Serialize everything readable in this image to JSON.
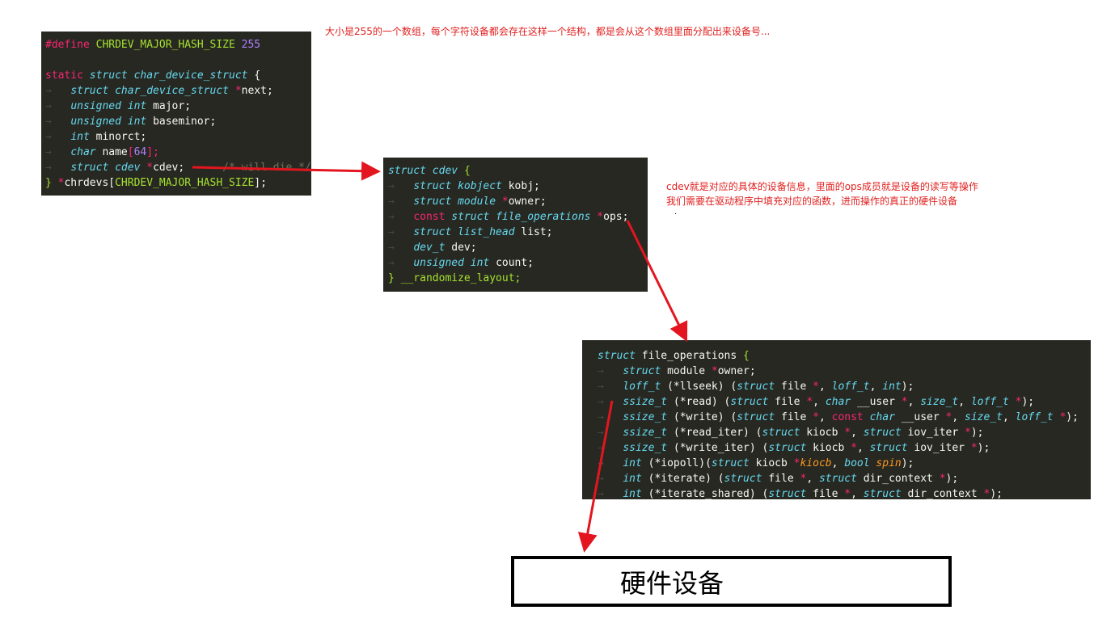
{
  "annotations": {
    "top_note": "大小是255的一个数组，每个字符设备都会存在这样一个结构，都是会从这个数组里面分配出来设备号...",
    "cdev_note_line1": "cdev就是对应的具体的设备信息，里面的ops成员就是设备的读写等操作",
    "cdev_note_line2": "我们需要在驱动程序中填充对应的函数，进而操作的真正的硬件设备",
    "cdev_note_dot": "."
  },
  "hardware_box": {
    "label": "硬件设备"
  },
  "code_char_device": {
    "define_kw": "#define",
    "define_name": "CHRDEV_MAJOR_HASH_SIZE",
    "define_value": "255",
    "static_kw": "static",
    "struct_kw": "struct",
    "struct_name": "char_device_struct",
    "open_brace": "{",
    "next_type": "struct char_device_struct",
    "next_star": "*",
    "next_name": "next;",
    "major_type": "unsigned int",
    "major_name": "major;",
    "baseminor_type": "unsigned int",
    "baseminor_name": "baseminor;",
    "minorct_type": "int",
    "minorct_name": "minorct;",
    "name_type": "char",
    "name_name": "name",
    "name_open": "[",
    "name_size": "64",
    "name_close": "];",
    "cdev_type": "struct cdev",
    "cdev_star": "*",
    "cdev_name": "cdev;",
    "cdev_comment": "/* will die */",
    "close_brace": "}",
    "arr_star": "*",
    "arr_name": "chrdevs[",
    "arr_size": "CHRDEV_MAJOR_HASH_SIZE",
    "arr_end": "];"
  },
  "code_cdev": {
    "struct_kw": "struct",
    "struct_name": "cdev",
    "open_brace": "{",
    "kobj_type": "struct kobject",
    "kobj_name": "kobj;",
    "owner_type": "struct module",
    "owner_star": "*",
    "owner_name": "owner;",
    "ops_const": "const",
    "ops_type": "struct file_operations",
    "ops_star": "*",
    "ops_name": "ops;",
    "list_type": "struct list_head",
    "list_name": "list;",
    "dev_type": "dev_t",
    "dev_name": "dev;",
    "count_type": "unsigned int",
    "count_name": "count;",
    "close_brace": "}",
    "attr": "__randomize_layout;"
  },
  "code_fops": {
    "struct_kw": "struct",
    "struct_name": "file_operations",
    "open_brace": "{",
    "lines": [
      [
        [
          "k",
          "struct"
        ],
        [
          "id",
          " module "
        ],
        [
          "op",
          "*"
        ],
        [
          "id",
          "owner;"
        ]
      ],
      [
        [
          "ti",
          "loff_t"
        ],
        [
          "id",
          " (*llseek) ("
        ],
        [
          "k",
          "struct"
        ],
        [
          "id",
          " file "
        ],
        [
          "op",
          "*"
        ],
        [
          "id",
          ", "
        ],
        [
          "ti",
          "loff_t"
        ],
        [
          "id",
          ", "
        ],
        [
          "ti",
          "int"
        ],
        [
          "id",
          ");"
        ]
      ],
      [
        [
          "ti",
          "ssize_t"
        ],
        [
          "id",
          " (*read) ("
        ],
        [
          "k",
          "struct"
        ],
        [
          "id",
          " file "
        ],
        [
          "op",
          "*"
        ],
        [
          "id",
          ", "
        ],
        [
          "k",
          "char"
        ],
        [
          "id",
          " __user "
        ],
        [
          "op",
          "*"
        ],
        [
          "id",
          ", "
        ],
        [
          "ti",
          "size_t"
        ],
        [
          "id",
          ", "
        ],
        [
          "ti",
          "loff_t"
        ],
        [
          "id",
          " "
        ],
        [
          "op",
          "*"
        ],
        [
          "id",
          ");"
        ]
      ],
      [
        [
          "ti",
          "ssize_t"
        ],
        [
          "id",
          " (*write) ("
        ],
        [
          "k",
          "struct"
        ],
        [
          "id",
          " file "
        ],
        [
          "op",
          "*"
        ],
        [
          "id",
          ", "
        ],
        [
          "kp",
          "const"
        ],
        [
          "id",
          " "
        ],
        [
          "k",
          "char"
        ],
        [
          "id",
          " __user "
        ],
        [
          "op",
          "*"
        ],
        [
          "id",
          ", "
        ],
        [
          "ti",
          "size_t"
        ],
        [
          "id",
          ", "
        ],
        [
          "ti",
          "loff_t"
        ],
        [
          "id",
          " "
        ],
        [
          "op",
          "*"
        ],
        [
          "id",
          ");"
        ]
      ],
      [
        [
          "ti",
          "ssize_t"
        ],
        [
          "id",
          " (*read_iter) ("
        ],
        [
          "k",
          "struct"
        ],
        [
          "id",
          " kiocb "
        ],
        [
          "op",
          "*"
        ],
        [
          "id",
          ", "
        ],
        [
          "k",
          "struct"
        ],
        [
          "id",
          " iov_iter "
        ],
        [
          "op",
          "*"
        ],
        [
          "id",
          ");"
        ]
      ],
      [
        [
          "ti",
          "ssize_t"
        ],
        [
          "id",
          " (*write_iter) ("
        ],
        [
          "k",
          "struct"
        ],
        [
          "id",
          " kiocb "
        ],
        [
          "op",
          "*"
        ],
        [
          "id",
          ", "
        ],
        [
          "k",
          "struct"
        ],
        [
          "id",
          " iov_iter "
        ],
        [
          "op",
          "*"
        ],
        [
          "id",
          ");"
        ]
      ],
      [
        [
          "ti",
          "int"
        ],
        [
          "id",
          " (*iopoll)("
        ],
        [
          "k",
          "struct"
        ],
        [
          "id",
          " kiocb "
        ],
        [
          "op",
          "*"
        ],
        [
          "arg",
          "kiocb"
        ],
        [
          "id",
          ", "
        ],
        [
          "ti",
          "bool"
        ],
        [
          "id",
          " "
        ],
        [
          "arg",
          "spin"
        ],
        [
          "id",
          ");"
        ]
      ],
      [
        [
          "ti",
          "int"
        ],
        [
          "id",
          " (*iterate) ("
        ],
        [
          "k",
          "struct"
        ],
        [
          "id",
          " file "
        ],
        [
          "op",
          "*"
        ],
        [
          "id",
          ", "
        ],
        [
          "k",
          "struct"
        ],
        [
          "id",
          " dir_context "
        ],
        [
          "op",
          "*"
        ],
        [
          "id",
          ");"
        ]
      ],
      [
        [
          "ti",
          "int"
        ],
        [
          "id",
          " (*iterate_shared) ("
        ],
        [
          "k",
          "struct"
        ],
        [
          "id",
          " file "
        ],
        [
          "op",
          "*"
        ],
        [
          "id",
          ", "
        ],
        [
          "k",
          "struct"
        ],
        [
          "id",
          " dir_context "
        ],
        [
          "op",
          "*"
        ],
        [
          "id",
          ");"
        ]
      ]
    ]
  },
  "colors": {
    "arrow": "#e3161f",
    "code_bg": "#272822",
    "note_text": "#e0201f"
  }
}
